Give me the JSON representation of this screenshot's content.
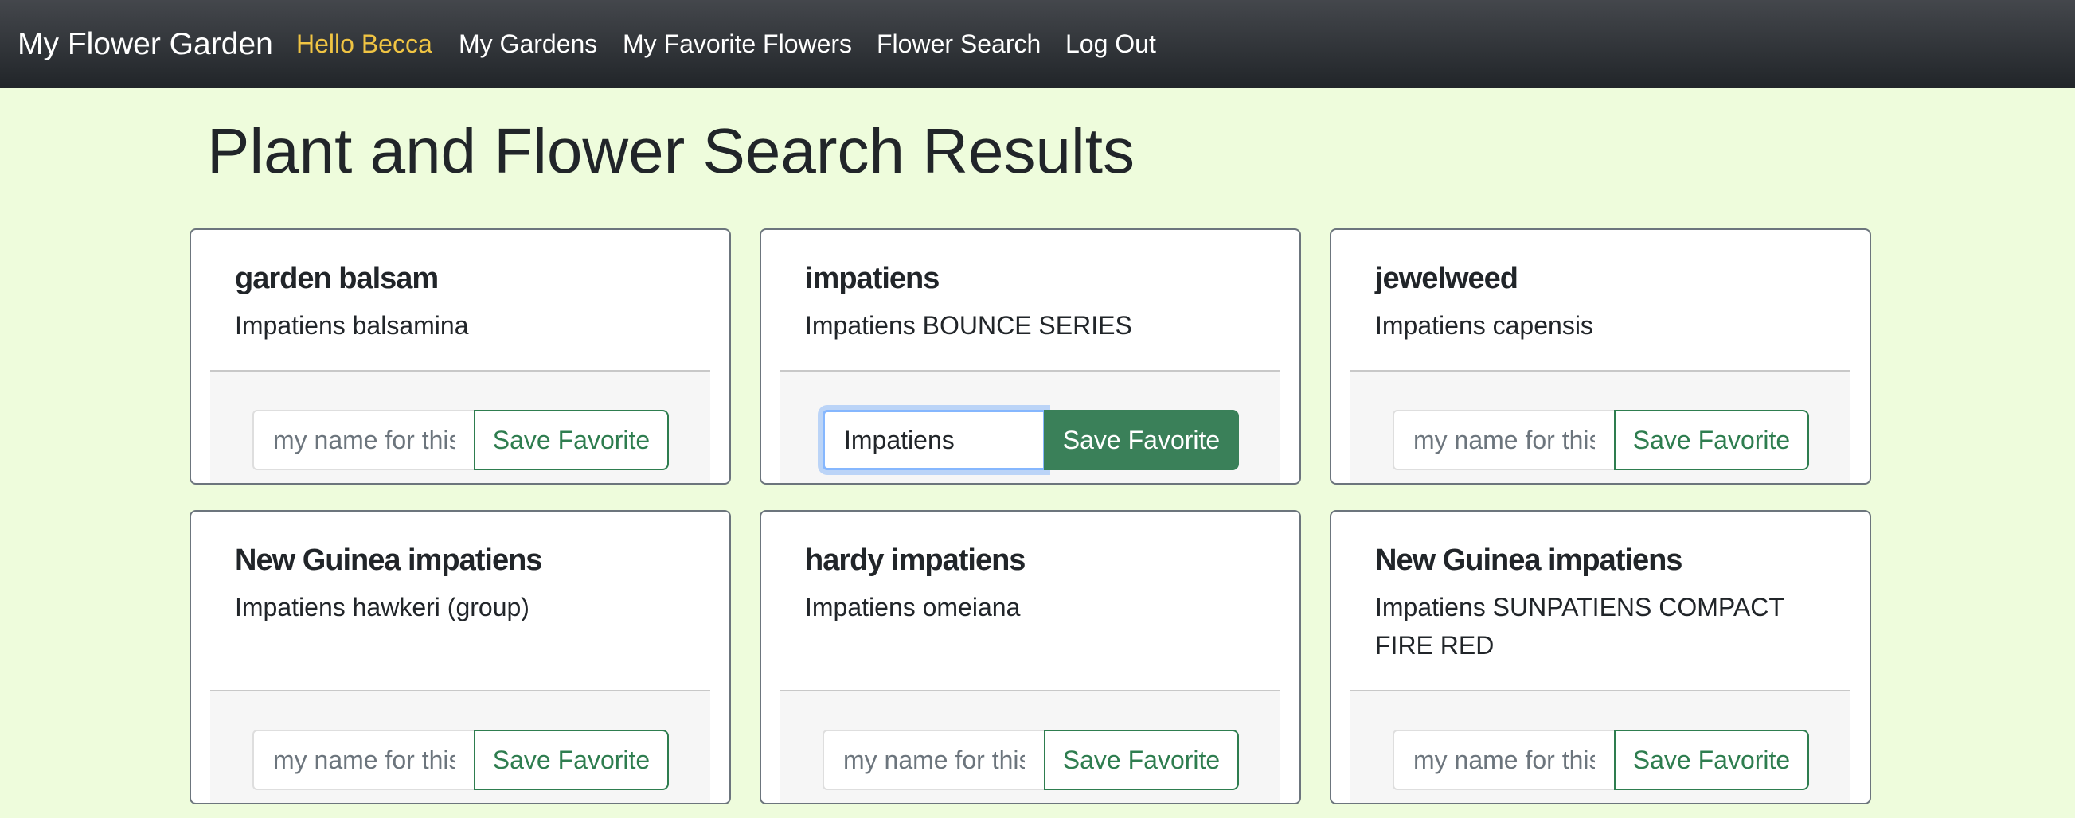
{
  "navbar": {
    "brand": "My Flower Garden",
    "greeting": "Hello Becca",
    "links": [
      "My Gardens",
      "My Favorite Flowers",
      "Flower Search",
      "Log Out"
    ],
    "greeting_color": "#f0c443"
  },
  "page": {
    "title": "Plant and Flower Search Results"
  },
  "colors": {
    "background": "#eefcdc",
    "accent_green": "#2e7d4f"
  },
  "cards": [
    {
      "common_name": "garden balsam",
      "scientific_name": "Impatiens balsamina",
      "input_value": "",
      "input_placeholder": "my name for this flower",
      "button_label": "Save Favorite"
    },
    {
      "common_name": "impatiens",
      "scientific_name": "Impatiens BOUNCE SERIES",
      "input_value": "Impatiens",
      "input_placeholder": "my name for this flower",
      "button_label": "Save Favorite"
    },
    {
      "common_name": "jewelweed",
      "scientific_name": "Impatiens capensis",
      "input_value": "",
      "input_placeholder": "my name for this flower",
      "button_label": "Save Favorite"
    },
    {
      "common_name": "New Guinea impatiens",
      "scientific_name": "Impatiens hawkeri (group)",
      "input_value": "",
      "input_placeholder": "my name for this flower",
      "button_label": "Save Favorite"
    },
    {
      "common_name": "hardy impatiens",
      "scientific_name": "Impatiens omeiana",
      "input_value": "",
      "input_placeholder": "my name for this flower",
      "button_label": "Save Favorite"
    },
    {
      "common_name": "New Guinea impatiens",
      "scientific_name": "Impatiens SUNPATIENS COMPACT FIRE RED",
      "input_value": "",
      "input_placeholder": "my name for this flower",
      "button_label": "Save Favorite"
    }
  ]
}
